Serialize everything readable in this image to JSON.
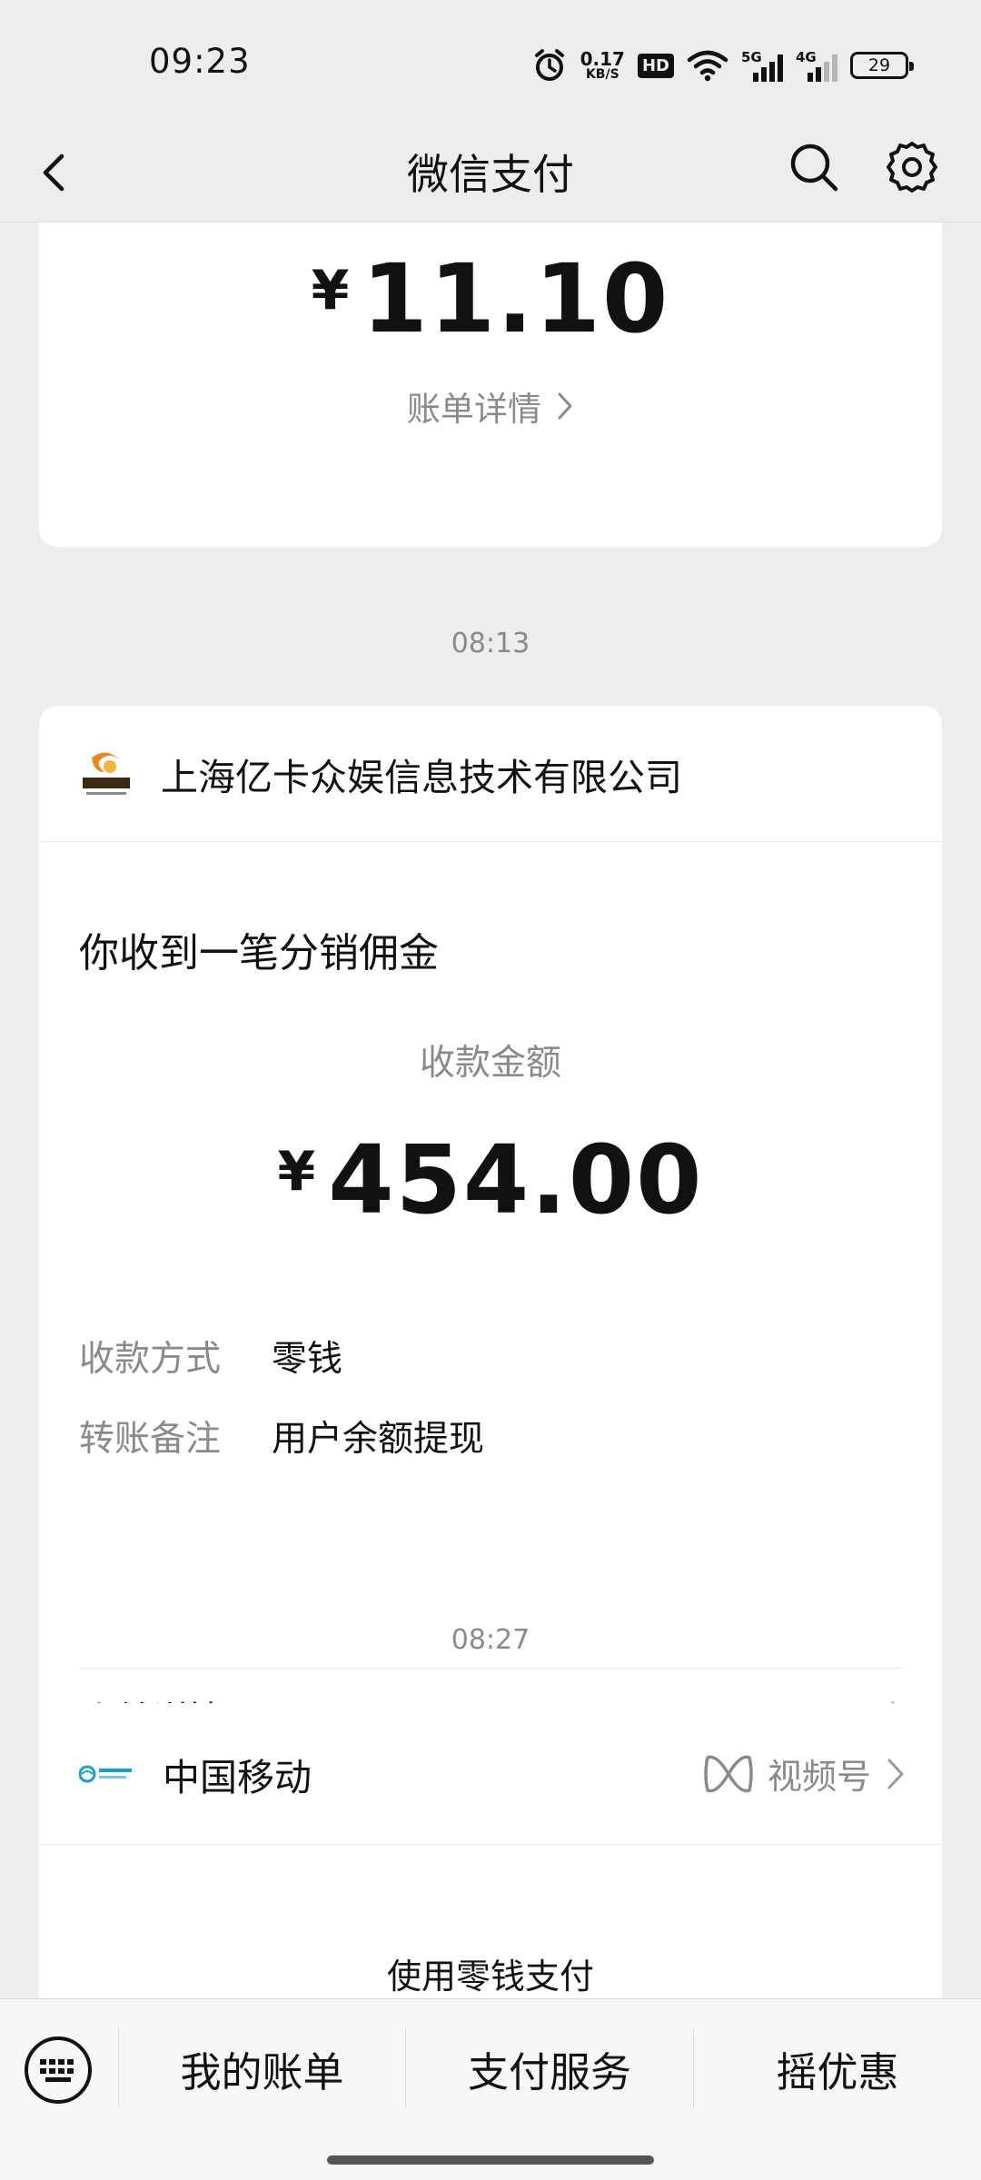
{
  "status_bar": {
    "time": "09:23",
    "net_speed_value": "0.17",
    "net_speed_unit": "KB/S",
    "hd_label": "HD",
    "net1_label": "5G",
    "net2_label": "4G",
    "battery": "29",
    "icons": [
      "alarm-icon",
      "wifi-icon",
      "signal-icon",
      "battery-icon"
    ]
  },
  "navbar": {
    "title": "微信支付",
    "icons": [
      "back-icon",
      "search-icon",
      "settings-icon"
    ]
  },
  "messages": [
    {
      "currency_symbol": "¥",
      "amount": "11.10",
      "detail_link": "账单详情"
    },
    {
      "time": "08:13",
      "merchant": "上海亿卡众娱信息技术有限公司",
      "title": "你收到一笔分销佣金",
      "amount_label": "收款金额",
      "currency_symbol": "¥",
      "amount": "454.00",
      "fields": [
        {
          "key": "收款方式",
          "value": "零钱"
        },
        {
          "key": "转账备注",
          "value": "用户余额提现"
        }
      ],
      "detail_link": "账单详情"
    },
    {
      "time": "08:27",
      "merchant": "中国移动",
      "channel_link": "视频号",
      "pay_method": "使用零钱支付"
    }
  ],
  "bottom_menu": {
    "items": [
      "我的账单",
      "支付服务",
      "摇优惠"
    ]
  },
  "colors": {
    "background": "#ededed",
    "card": "#ffffff",
    "secondary_text": "#8a8a8a"
  }
}
